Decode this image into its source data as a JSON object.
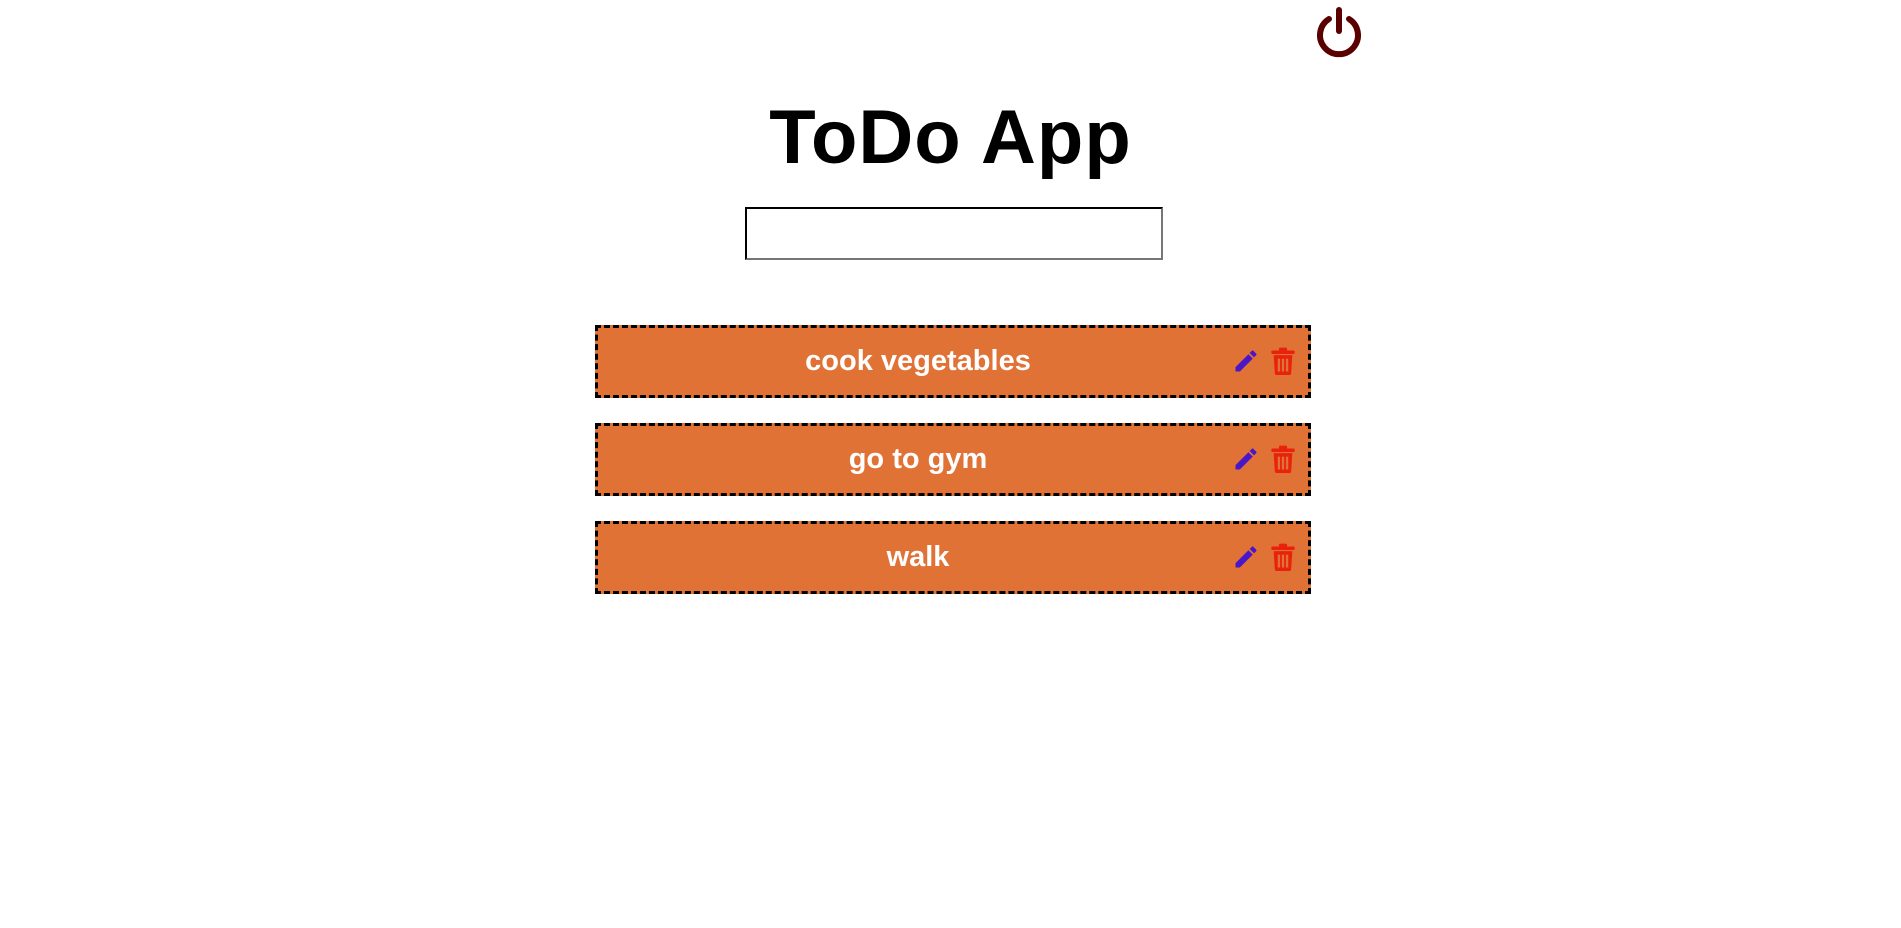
{
  "app": {
    "title": "ToDo App"
  },
  "header": {
    "logout_icon": "power-icon",
    "logout_color": "#5a0000"
  },
  "input": {
    "value": "",
    "placeholder": ""
  },
  "todos": [
    {
      "text": "cook vegetables",
      "edit_icon": "pencil-icon",
      "delete_icon": "trash-icon"
    },
    {
      "text": "go to gym",
      "edit_icon": "pencil-icon",
      "delete_icon": "trash-icon"
    },
    {
      "text": "walk",
      "edit_icon": "pencil-icon",
      "delete_icon": "trash-icon"
    }
  ],
  "colors": {
    "item_background": "#e07236",
    "item_text": "#ffffff",
    "edit_icon": "#4a17c8",
    "delete_icon": "#e8220c",
    "title_text": "#000000"
  }
}
